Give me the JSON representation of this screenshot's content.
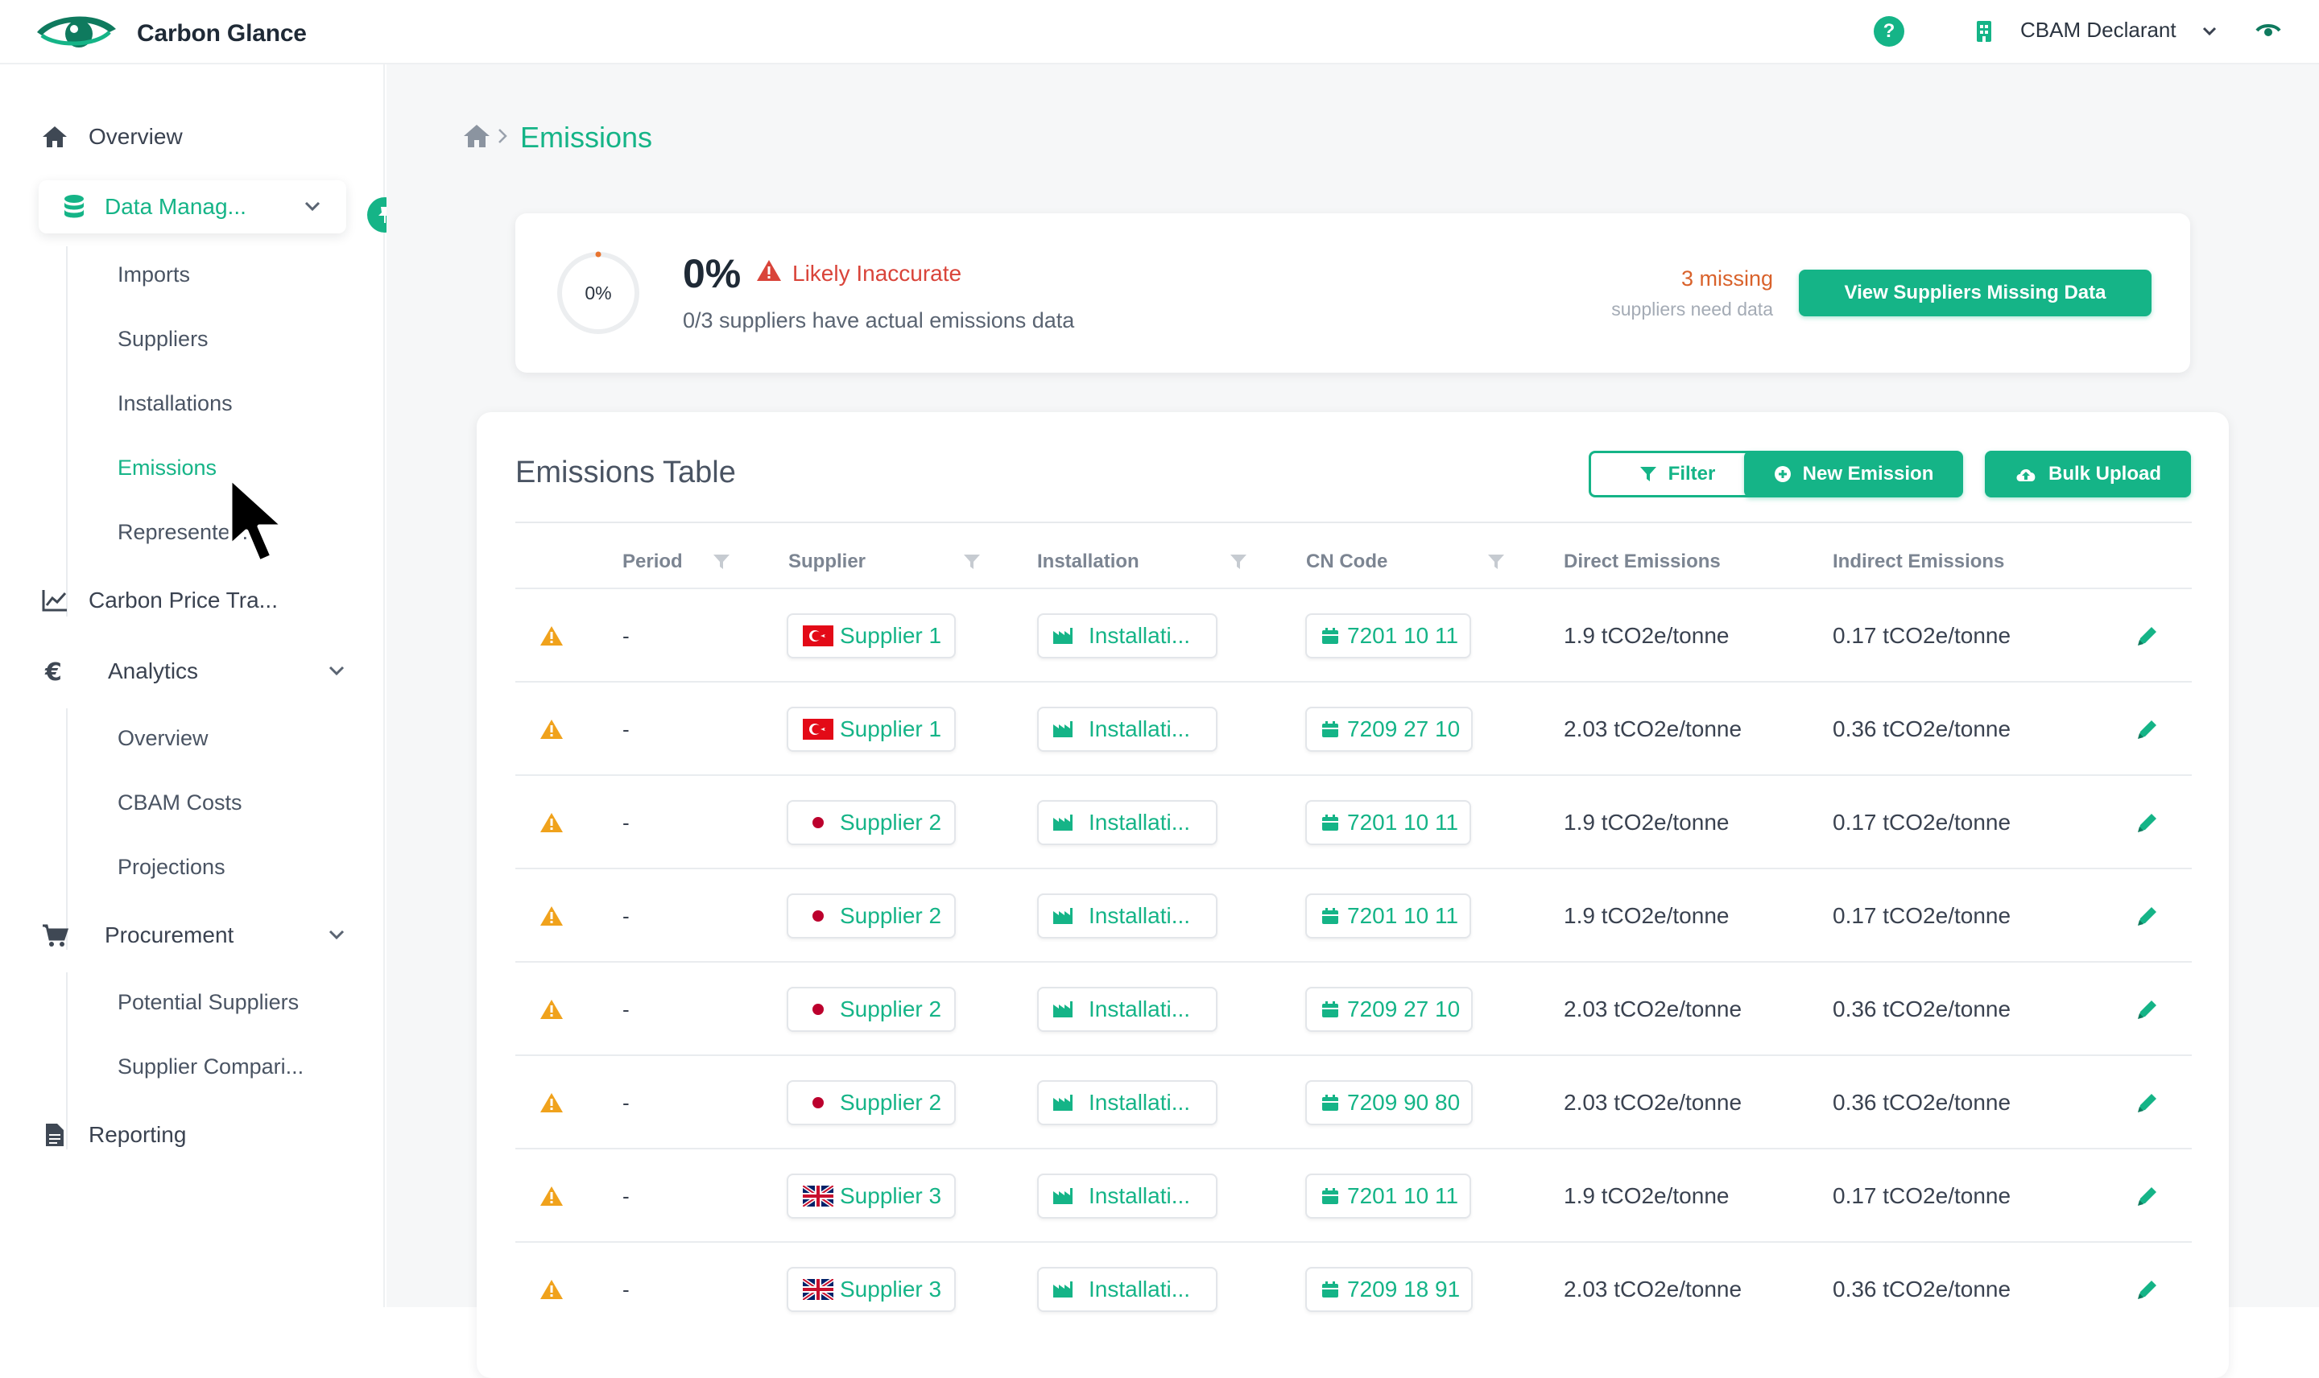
{
  "app": {
    "name": "Carbon Glance"
  },
  "topbar": {
    "help": "?",
    "role": "CBAM Declarant"
  },
  "sidebar": {
    "overview": "Overview",
    "data_management": "Data Manag...",
    "data_sub": [
      "Imports",
      "Suppliers",
      "Installations",
      "Emissions",
      "Represente..."
    ],
    "carbon_price": "Carbon Price Tra...",
    "analytics": "Analytics",
    "analytics_sub": [
      "Overview",
      "CBAM Costs",
      "Projections"
    ],
    "procurement": "Procurement",
    "procurement_sub": [
      "Potential Suppliers",
      "Supplier Compari..."
    ],
    "reporting": "Reporting"
  },
  "breadcrumb": {
    "title": "Emissions"
  },
  "summary": {
    "ring_value": "0%",
    "percent": "0%",
    "status": "Likely Inaccurate",
    "subtitle": "0/3 suppliers have actual emissions data",
    "missing": "3 missing",
    "missing_sub": "suppliers need data",
    "button": "View Suppliers Missing Data"
  },
  "table": {
    "title": "Emissions Table",
    "filter_label": "Filter",
    "new_label": "New Emission",
    "bulk_label": "Bulk Upload",
    "headers": [
      "Period",
      "Supplier",
      "Installation",
      "CN Code",
      "Direct Emissions",
      "Indirect Emissions"
    ],
    "rows": [
      {
        "period": "-",
        "flag": "tr",
        "supplier": "Supplier 1",
        "installation": "Installati...",
        "cn": "7201 10 11",
        "direct": "1.9 tCO2e/tonne",
        "indirect": "0.17 tCO2e/tonne"
      },
      {
        "period": "-",
        "flag": "tr",
        "supplier": "Supplier 1",
        "installation": "Installati...",
        "cn": "7209 27 10",
        "direct": "2.03 tCO2e/tonne",
        "indirect": "0.36 tCO2e/tonne"
      },
      {
        "period": "-",
        "flag": "jp",
        "supplier": "Supplier 2",
        "installation": "Installati...",
        "cn": "7201 10 11",
        "direct": "1.9 tCO2e/tonne",
        "indirect": "0.17 tCO2e/tonne"
      },
      {
        "period": "-",
        "flag": "jp",
        "supplier": "Supplier 2",
        "installation": "Installati...",
        "cn": "7201 10 11",
        "direct": "1.9 tCO2e/tonne",
        "indirect": "0.17 tCO2e/tonne"
      },
      {
        "period": "-",
        "flag": "jp",
        "supplier": "Supplier 2",
        "installation": "Installati...",
        "cn": "7209 27 10",
        "direct": "2.03 tCO2e/tonne",
        "indirect": "0.36 tCO2e/tonne"
      },
      {
        "period": "-",
        "flag": "jp",
        "supplier": "Supplier 2",
        "installation": "Installati...",
        "cn": "7209 90 80",
        "direct": "2.03 tCO2e/tonne",
        "indirect": "0.36 tCO2e/tonne"
      },
      {
        "period": "-",
        "flag": "gb",
        "supplier": "Supplier 3",
        "installation": "Installati...",
        "cn": "7201 10 11",
        "direct": "1.9 tCO2e/tonne",
        "indirect": "0.17 tCO2e/tonne"
      },
      {
        "period": "-",
        "flag": "gb",
        "supplier": "Supplier 3",
        "installation": "Installati...",
        "cn": "7209 18 91",
        "direct": "2.03 tCO2e/tonne",
        "indirect": "0.36 tCO2e/tonne"
      }
    ]
  },
  "colors": {
    "accent": "#15b487",
    "warning": "#f0a21c",
    "danger": "#d9443a",
    "missing": "#d9622b"
  },
  "icons": [
    "eye-logo-icon",
    "help-icon",
    "building-icon",
    "chevron-down-icon",
    "eye-icon",
    "home-icon",
    "database-icon",
    "pin-icon",
    "chart-line-icon",
    "euro-icon",
    "cart-icon",
    "document-icon",
    "warning-icon",
    "filter-icon",
    "plus-circle-icon",
    "cloud-upload-icon",
    "factory-icon",
    "calendar-icon",
    "pencil-icon",
    "cursor-icon"
  ]
}
